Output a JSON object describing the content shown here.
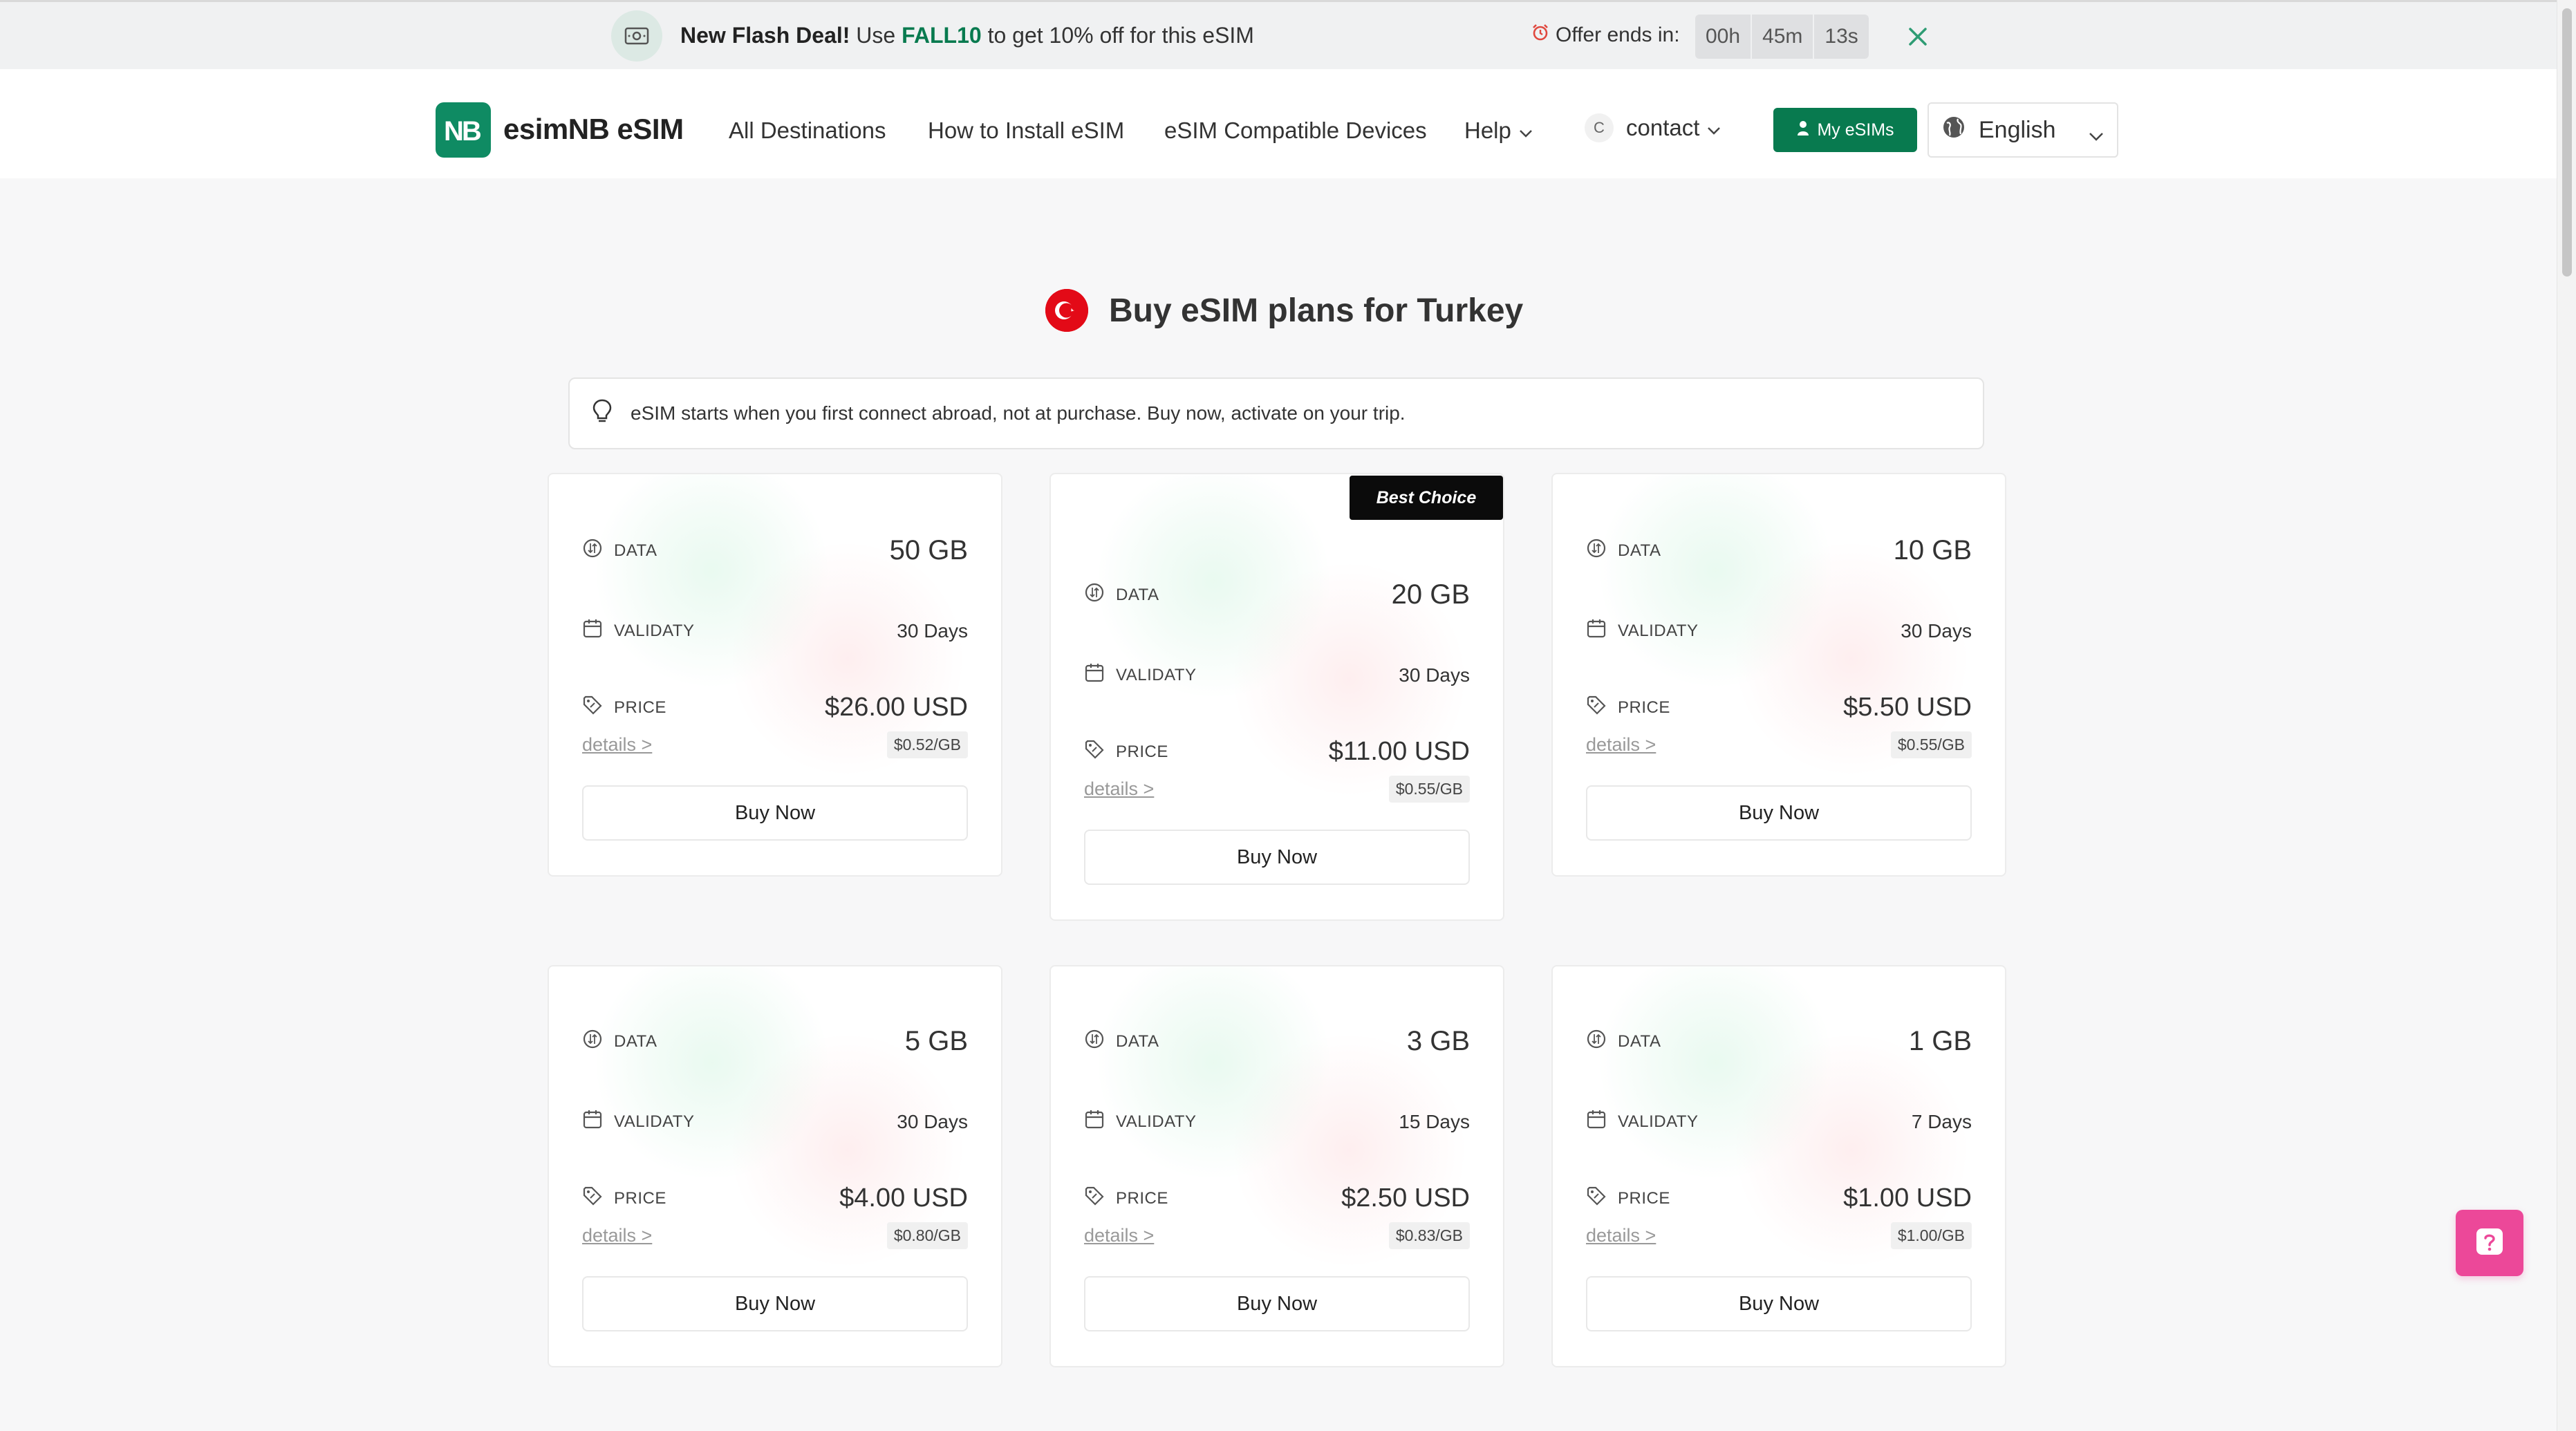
{
  "promo": {
    "headline": "New Flash Deal!",
    "text_before": "Use",
    "code": "FALL10",
    "text_after": "to get 10% off for this eSIM",
    "offer_label": "Offer ends in:",
    "timer": {
      "hours": "00h",
      "minutes": "45m",
      "seconds": "13s"
    },
    "icon": "ticket-icon"
  },
  "header": {
    "logo_letters": "NB",
    "brand": "esimNB eSIM",
    "nav": {
      "destinations": "All Destinations",
      "install": "How to Install eSIM",
      "devices": "eSIM Compatible Devices",
      "help": "Help",
      "contact_avatar": "C",
      "contact": "contact"
    },
    "my_esims": "My eSIMs",
    "language": "English"
  },
  "main": {
    "title": "Buy eSIM plans for Turkey",
    "notice": "eSIM starts when you first connect abroad, not at purchase. Buy now, activate on your trip.",
    "best_badge": "Best Choice",
    "labels": {
      "data": "DATA",
      "validity": "VALIDATY",
      "price": "PRICE",
      "details": "details >",
      "buy": "Buy Now"
    },
    "plans": [
      {
        "data": "50 GB",
        "validity": "30 Days",
        "price": "$26.00 USD",
        "per_gb": "$0.52/GB"
      },
      {
        "data": "20 GB",
        "validity": "30 Days",
        "price": "$11.00 USD",
        "per_gb": "$0.55/GB"
      },
      {
        "data": "10 GB",
        "validity": "30 Days",
        "price": "$5.50 USD",
        "per_gb": "$0.55/GB"
      },
      {
        "data": "5 GB",
        "validity": "30 Days",
        "price": "$4.00 USD",
        "per_gb": "$0.80/GB"
      },
      {
        "data": "3 GB",
        "validity": "15 Days",
        "price": "$2.50 USD",
        "per_gb": "$0.83/GB"
      },
      {
        "data": "1 GB",
        "validity": "7 Days",
        "price": "$1.00 USD",
        "per_gb": "$1.00/GB"
      }
    ]
  },
  "colors": {
    "brand": "#087a4f",
    "help_button": "#ec4899",
    "flag": "#e30a17"
  }
}
